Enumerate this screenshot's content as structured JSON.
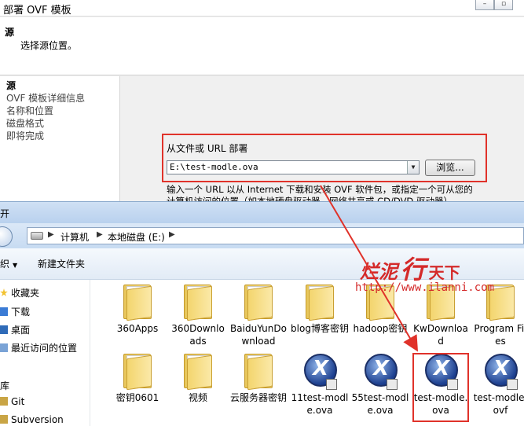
{
  "ovf": {
    "title": "部署 OVF 模板",
    "header_title": "源",
    "header_subtitle": "选择源位置。",
    "nav_items": [
      {
        "label": "源",
        "active": true
      },
      {
        "label": "OVF 模板详细信息",
        "active": false
      },
      {
        "label": "名称和位置",
        "active": false
      },
      {
        "label": "磁盘格式",
        "active": false
      },
      {
        "label": "即将完成",
        "active": false
      }
    ],
    "source_label": "从文件或 URL 部署",
    "source_path": "E:\\test-modle.ova",
    "browse_label": "浏览...",
    "help_text": "输入一个 URL 以从 Internet 下载和安装 OVF 软件包，或指定一个可从您的计算机访问的位置（如本地硬盘驱动器、网络共享或 CD/DVD 驱动器）。"
  },
  "explorer": {
    "title": "开",
    "breadcrumb": [
      "计算机",
      "本地磁盘 (E:)"
    ],
    "toolbar": {
      "organize": "织",
      "new_folder": "新建文件夹"
    },
    "sidebar": [
      {
        "label": "收藏夹",
        "icon": "star-icon"
      },
      {
        "label": "下载",
        "icon": "download-icon"
      },
      {
        "label": "桌面",
        "icon": "desktop-icon"
      },
      {
        "label": "最近访问的位置",
        "icon": "recent-icon"
      },
      {
        "label": "库",
        "icon": ""
      },
      {
        "label": "Git",
        "icon": "library-icon"
      },
      {
        "label": "Subversion",
        "icon": "library-icon"
      }
    ],
    "files": [
      {
        "label": "360Apps",
        "type": "folder"
      },
      {
        "label": "360Downloads",
        "type": "folder"
      },
      {
        "label": "BaiduYunDownload",
        "type": "folder"
      },
      {
        "label": "blog博客密钥",
        "type": "folder"
      },
      {
        "label": "hadoop密钥",
        "type": "folder"
      },
      {
        "label": "KwDownload",
        "type": "folder"
      },
      {
        "label": "Program Files",
        "type": "folder"
      },
      {
        "label": "密钥0601",
        "type": "folder"
      },
      {
        "label": "视频",
        "type": "folder"
      },
      {
        "label": "云服务器密钥",
        "type": "folder"
      },
      {
        "label": "11test-modle.ova",
        "type": "ova"
      },
      {
        "label": "55test-modle.ova",
        "type": "ova"
      },
      {
        "label": "test-modle.ova",
        "type": "ova"
      },
      {
        "label": "test-modle.ovf",
        "type": "ova"
      }
    ]
  },
  "watermark": {
    "part1": "烂泥",
    "part2": "行",
    "part3": "天下",
    "url": "http://www.ilanni.com"
  },
  "colors": {
    "highlight": "#e0322a",
    "watermark": "#d42a2a"
  }
}
